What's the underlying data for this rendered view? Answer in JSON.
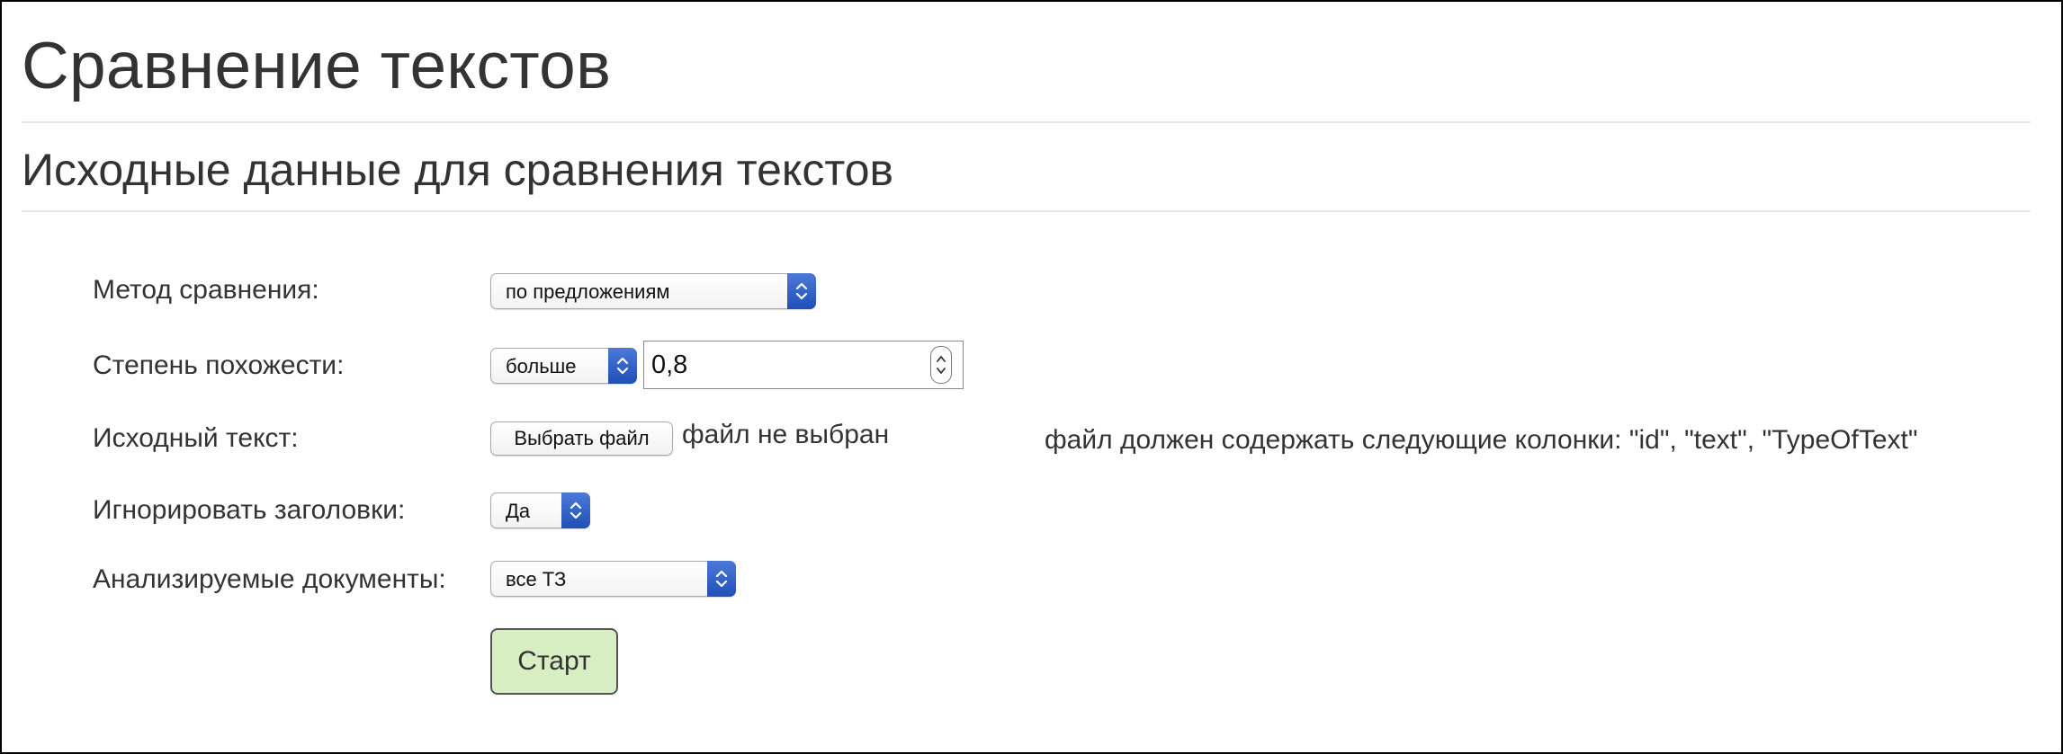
{
  "page": {
    "title": "Сравнение текстов",
    "section_title": "Исходные данные для сравнения текстов"
  },
  "form": {
    "method": {
      "label": "Метод сравнения:",
      "selected": "по предложениям"
    },
    "similarity": {
      "label": "Степень похожести:",
      "operator": "больше",
      "value": "0,8"
    },
    "source_text": {
      "label": "Исходный текст:",
      "button_label": "Выбрать файл",
      "status": "файл не выбран",
      "hint": "файл должен содержать следующие колонки: \"id\", \"text\", \"TypeOfText\""
    },
    "ignore_headers": {
      "label": "Игнорировать заголовки:",
      "selected": "Да"
    },
    "documents": {
      "label": "Анализируемые документы:",
      "selected": "все ТЗ"
    },
    "start_label": "Старт"
  },
  "icons": {
    "select_arrows": "chevron-up-down-icon",
    "spinner": "spinner-arrows-icon"
  },
  "colors": {
    "select_accent": "#2a5cc6",
    "start_button_bg": "#d8efc3"
  }
}
